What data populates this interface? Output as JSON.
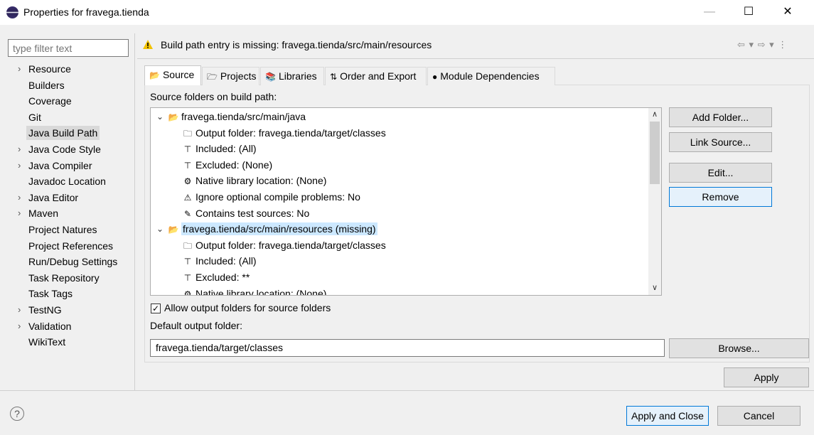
{
  "window": {
    "title": "Properties for fravega.tienda",
    "min": "—",
    "max": "☐",
    "close": "✕"
  },
  "filter": {
    "placeholder": "type filter text"
  },
  "nav": [
    {
      "label": "Resource",
      "expandable": true
    },
    {
      "label": "Builders"
    },
    {
      "label": "Coverage"
    },
    {
      "label": "Git"
    },
    {
      "label": "Java Build Path",
      "selected": true
    },
    {
      "label": "Java Code Style",
      "expandable": true
    },
    {
      "label": "Java Compiler",
      "expandable": true
    },
    {
      "label": "Javadoc Location"
    },
    {
      "label": "Java Editor",
      "expandable": true
    },
    {
      "label": "Maven",
      "expandable": true
    },
    {
      "label": "Project Natures"
    },
    {
      "label": "Project References"
    },
    {
      "label": "Run/Debug Settings"
    },
    {
      "label": "Task Repository"
    },
    {
      "label": "Task Tags"
    },
    {
      "label": "TestNG",
      "expandable": true
    },
    {
      "label": "Validation",
      "expandable": true
    },
    {
      "label": "WikiText"
    }
  ],
  "message": {
    "text": "Build path entry is missing: fravega.tienda/src/main/resources",
    "nav": "⇦ ▾ ⇨ ▾ ⋮"
  },
  "tabs": [
    {
      "label": "Source",
      "icon": "source-folder-icon",
      "glyph": "📂"
    },
    {
      "label": "Projects",
      "icon": "projects-icon",
      "glyph": "🗁"
    },
    {
      "label": "Libraries",
      "icon": "libraries-icon",
      "glyph": "📚"
    },
    {
      "label": "Order and Export",
      "icon": "order-export-icon",
      "glyph": "⇅"
    },
    {
      "label": "Module Dependencies",
      "icon": "module-icon",
      "glyph": "●"
    }
  ],
  "source": {
    "label": "Source folders on build path:",
    "tree": [
      {
        "label": "fravega.tienda/src/main/java",
        "level": 0,
        "icon": "source-folder-icon",
        "glyph": "📂"
      },
      {
        "label": "Output folder: fravega.tienda/target/classes",
        "level": 1,
        "icon": "output-folder-icon",
        "glyph": "🗀"
      },
      {
        "label": "Included: (All)",
        "level": 1,
        "icon": "filter-icon",
        "glyph": "⊤"
      },
      {
        "label": "Excluded: (None)",
        "level": 1,
        "icon": "filter-icon",
        "glyph": "⊤"
      },
      {
        "label": "Native library location: (None)",
        "level": 1,
        "icon": "native-library-icon",
        "glyph": "⚙"
      },
      {
        "label": "Ignore optional compile problems: No",
        "level": 1,
        "icon": "ignore-problems-icon",
        "glyph": "⚠"
      },
      {
        "label": "Contains test sources: No",
        "level": 1,
        "icon": "test-sources-icon",
        "glyph": "✎"
      },
      {
        "label": "fravega.tienda/src/main/resources (missing)",
        "level": 0,
        "icon": "missing-folder-icon",
        "glyph": "📂",
        "selected": true
      },
      {
        "label": "Output folder: fravega.tienda/target/classes",
        "level": 1,
        "icon": "output-folder-icon",
        "glyph": "🗀"
      },
      {
        "label": "Included: (All)",
        "level": 1,
        "icon": "filter-icon",
        "glyph": "⊤"
      },
      {
        "label": "Excluded: **",
        "level": 1,
        "icon": "filter-icon",
        "glyph": "⊤"
      },
      {
        "label": "Native library location: (None)",
        "level": 1,
        "icon": "native-library-icon",
        "glyph": "⚙"
      }
    ],
    "buttons": {
      "add_folder": "Add Folder...",
      "link_source": "Link Source...",
      "edit": "Edit...",
      "remove": "Remove"
    }
  },
  "allow_output": {
    "label": "Allow output folders for source folders",
    "checked": true,
    "mark": "✓"
  },
  "default_output": {
    "label": "Default output folder:",
    "value": "fravega.tienda/target/classes",
    "browse": "Browse..."
  },
  "footer": {
    "apply": "Apply",
    "apply_close": "Apply and Close",
    "cancel": "Cancel",
    "help": "?"
  }
}
